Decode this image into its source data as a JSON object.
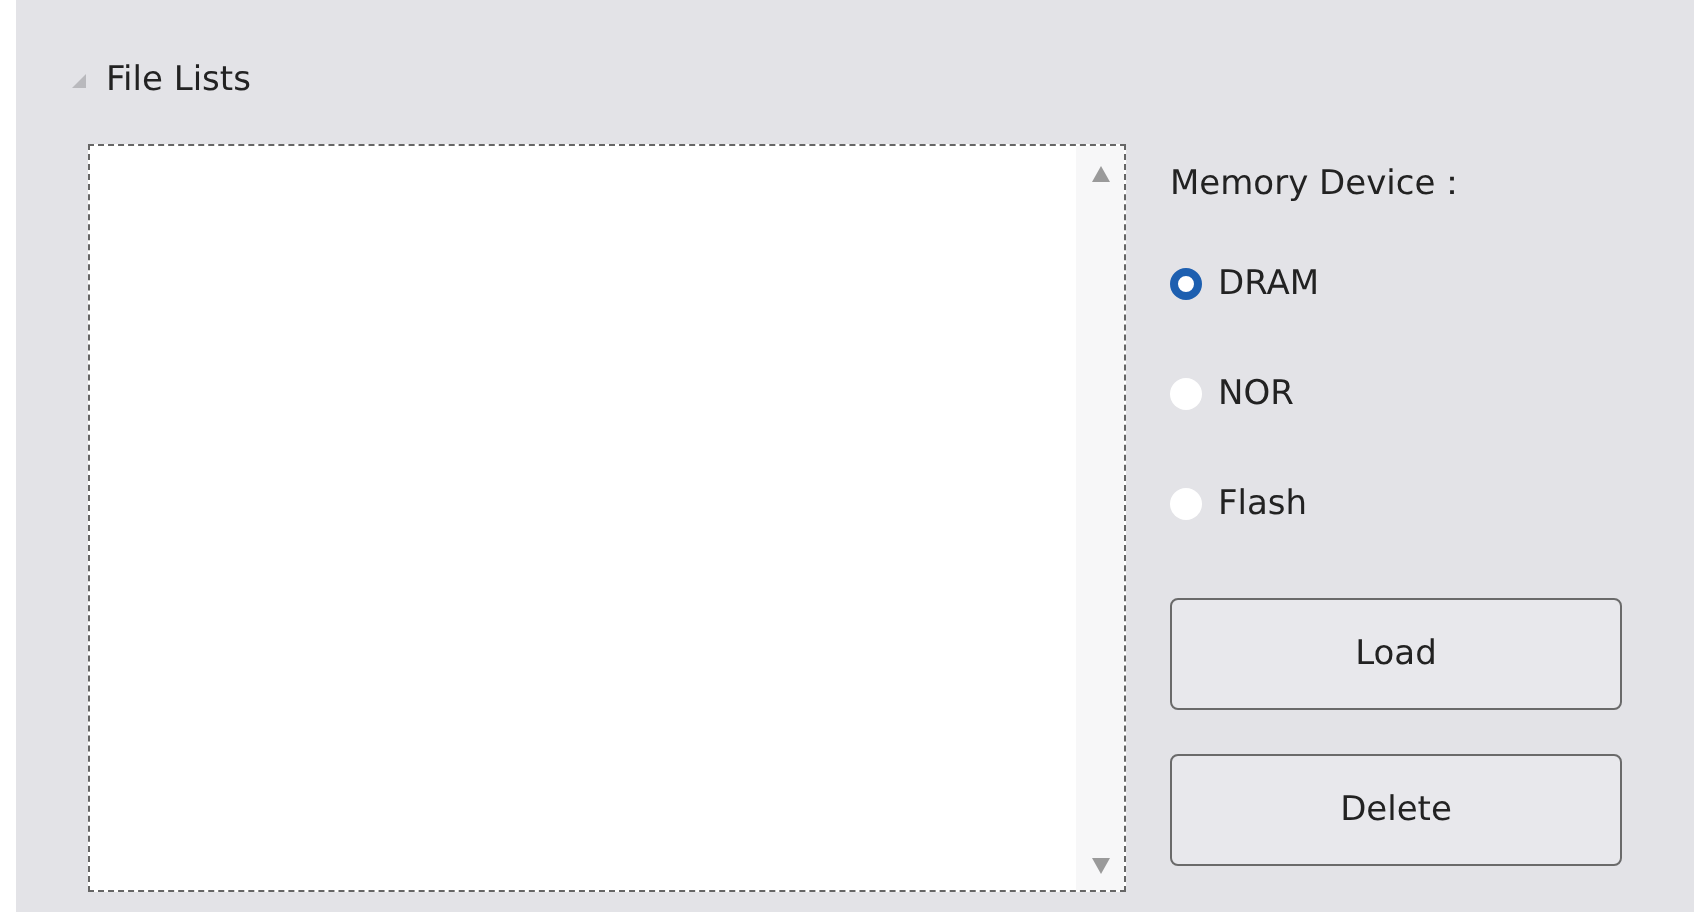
{
  "group": {
    "title": "File Lists",
    "expanded": true
  },
  "memory": {
    "label": "Memory Device：",
    "options": [
      {
        "label": "DRAM",
        "selected": true
      },
      {
        "label": "NOR",
        "selected": false
      },
      {
        "label": "Flash",
        "selected": false
      }
    ]
  },
  "buttons": [
    "Load",
    "Delete"
  ]
}
